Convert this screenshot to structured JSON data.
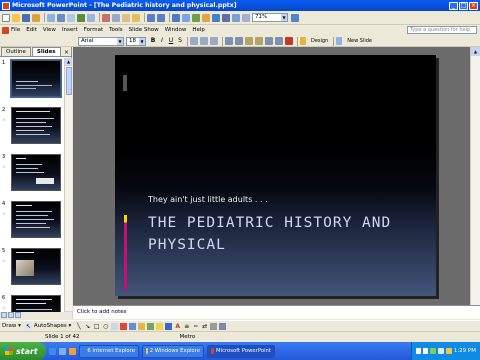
{
  "window": {
    "title": "Microsoft PowerPoint - [The Pediatric history and physical.pptx]"
  },
  "standard_toolbar": {
    "zoom": "71%"
  },
  "formatting_toolbar": {
    "font": "Arial",
    "font_size": "18",
    "bold": "B",
    "italic": "I",
    "underline": "U",
    "shadow": "S",
    "design_label": "Design",
    "new_slide_label": "New Slide"
  },
  "menu": {
    "items": [
      "File",
      "Edit",
      "View",
      "Insert",
      "Format",
      "Tools",
      "Slide Show",
      "Window",
      "Help"
    ],
    "help_placeholder": "Type a question for help"
  },
  "left_pane": {
    "tabs": [
      "Outline",
      "Slides"
    ],
    "close": "×",
    "thumbnails": [
      {
        "num": "1"
      },
      {
        "num": "2"
      },
      {
        "num": "3"
      },
      {
        "num": "4"
      },
      {
        "num": "5"
      },
      {
        "num": "6"
      }
    ]
  },
  "slide": {
    "subtitle": "They ain't just little adults . . .",
    "title": "The Pediatric History and Physical"
  },
  "notes": {
    "placeholder": "Click to add notes"
  },
  "drawing_toolbar": {
    "draw_label": "Draw ▾",
    "autoshapes_label": "AutoShapes ▾"
  },
  "status_bar": {
    "slide_position": "Slide 1 of 42",
    "design_name": "Metro"
  },
  "taskbar": {
    "start_label": "start",
    "tasks": [
      {
        "label": "6 Internet Explore",
        "color": "#2b83d8"
      },
      {
        "label": "2 Windows Explore",
        "color": "#f2c94c"
      },
      {
        "label": "Microsoft PowerPoint",
        "color": "#d24625"
      }
    ],
    "clock": "1:29 PM"
  },
  "colors": {
    "title_bar": "#0a5ef5",
    "slide_title": "#cfd9f2",
    "taskbar": "#2358d8",
    "start_button": "#2e8b2d"
  }
}
